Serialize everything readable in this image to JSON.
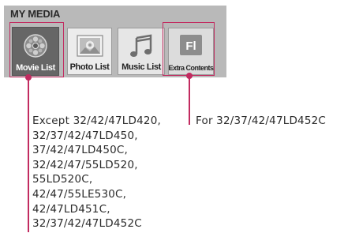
{
  "panel": {
    "title": "MY MEDIA",
    "items": [
      {
        "label": "Movie List",
        "icon": "film-reel-icon",
        "selected": true
      },
      {
        "label": "Photo List",
        "icon": "photo-icon",
        "selected": false
      },
      {
        "label": "Music List",
        "icon": "music-note-icon",
        "selected": false
      },
      {
        "label": "Extra Contents",
        "icon": "fl-icon",
        "icon_text": "Fl",
        "selected": false
      }
    ]
  },
  "annotations": {
    "left_lines": [
      "Except 32/42/47LD420,",
      "32/37/42/47LD450,",
      "37/42/47LD450C,",
      "32/42/47/55LD520,",
      "55LD520C,",
      "42/47/55LE530C,",
      "42/47LD451C,",
      "32/37/42/47LD452C"
    ],
    "right_text": "For 32/37/42/47LD452C"
  },
  "colors": {
    "accent": "#c22b60",
    "panel_bg": "#b9b9b9",
    "selected_bg": "#666666"
  }
}
